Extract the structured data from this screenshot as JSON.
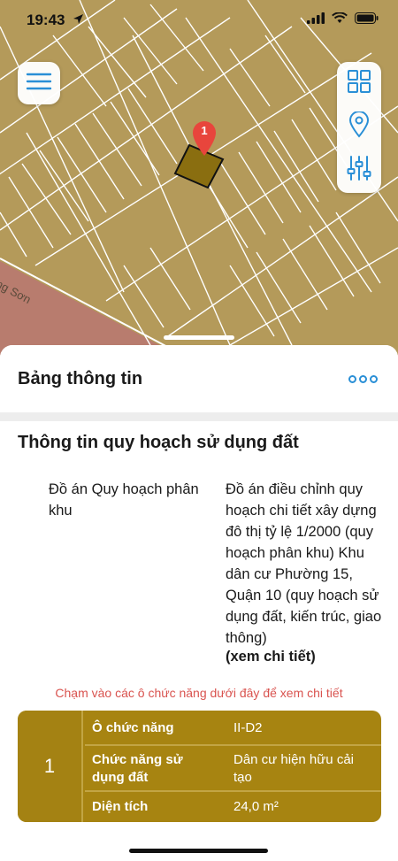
{
  "status_bar": {
    "time": "19:43"
  },
  "map": {
    "road_label": "ng Sơn",
    "marker_label": "1",
    "colors": {
      "parcel_fill": "#b49a5a",
      "line": "#ffffff",
      "selected_parcel": "#8a6e10",
      "marker": "#e8453c",
      "road": "#b87c6e"
    }
  },
  "controls": {
    "menu_icon": "hamburger-menu-icon",
    "grid_icon": "grid-view-icon",
    "location_icon": "location-pin-icon",
    "filter_icon": "sliders-icon"
  },
  "panel": {
    "title": "Bảng thông tin",
    "more_icon": "more-dots-icon",
    "section_title": "Thông tin quy hoạch sử dụng đất",
    "plan_label": "Đồ án Quy hoạch phân khu",
    "plan_value": "Đồ án điều chỉnh quy hoạch chi tiết xây dựng đô thị tỷ lệ 1/2000 (quy hoạch phân khu) Khu dân cư Phường 15, Quận 10 (quy hoạch sử dụng đất, kiến trúc, giao thông)",
    "plan_link": "(xem chi tiết)",
    "hint": "Chạm vào các ô chức năng dưới đây để xem chi tiết",
    "function_table": {
      "index": "1",
      "rows": [
        {
          "key": "Ô chức năng",
          "value": "II-D2"
        },
        {
          "key": "Chức năng sử dụng đất",
          "value": "Dân cư hiện hữu cải tạo"
        },
        {
          "key": "Diện tích",
          "value": "24,0 m²"
        }
      ]
    }
  }
}
